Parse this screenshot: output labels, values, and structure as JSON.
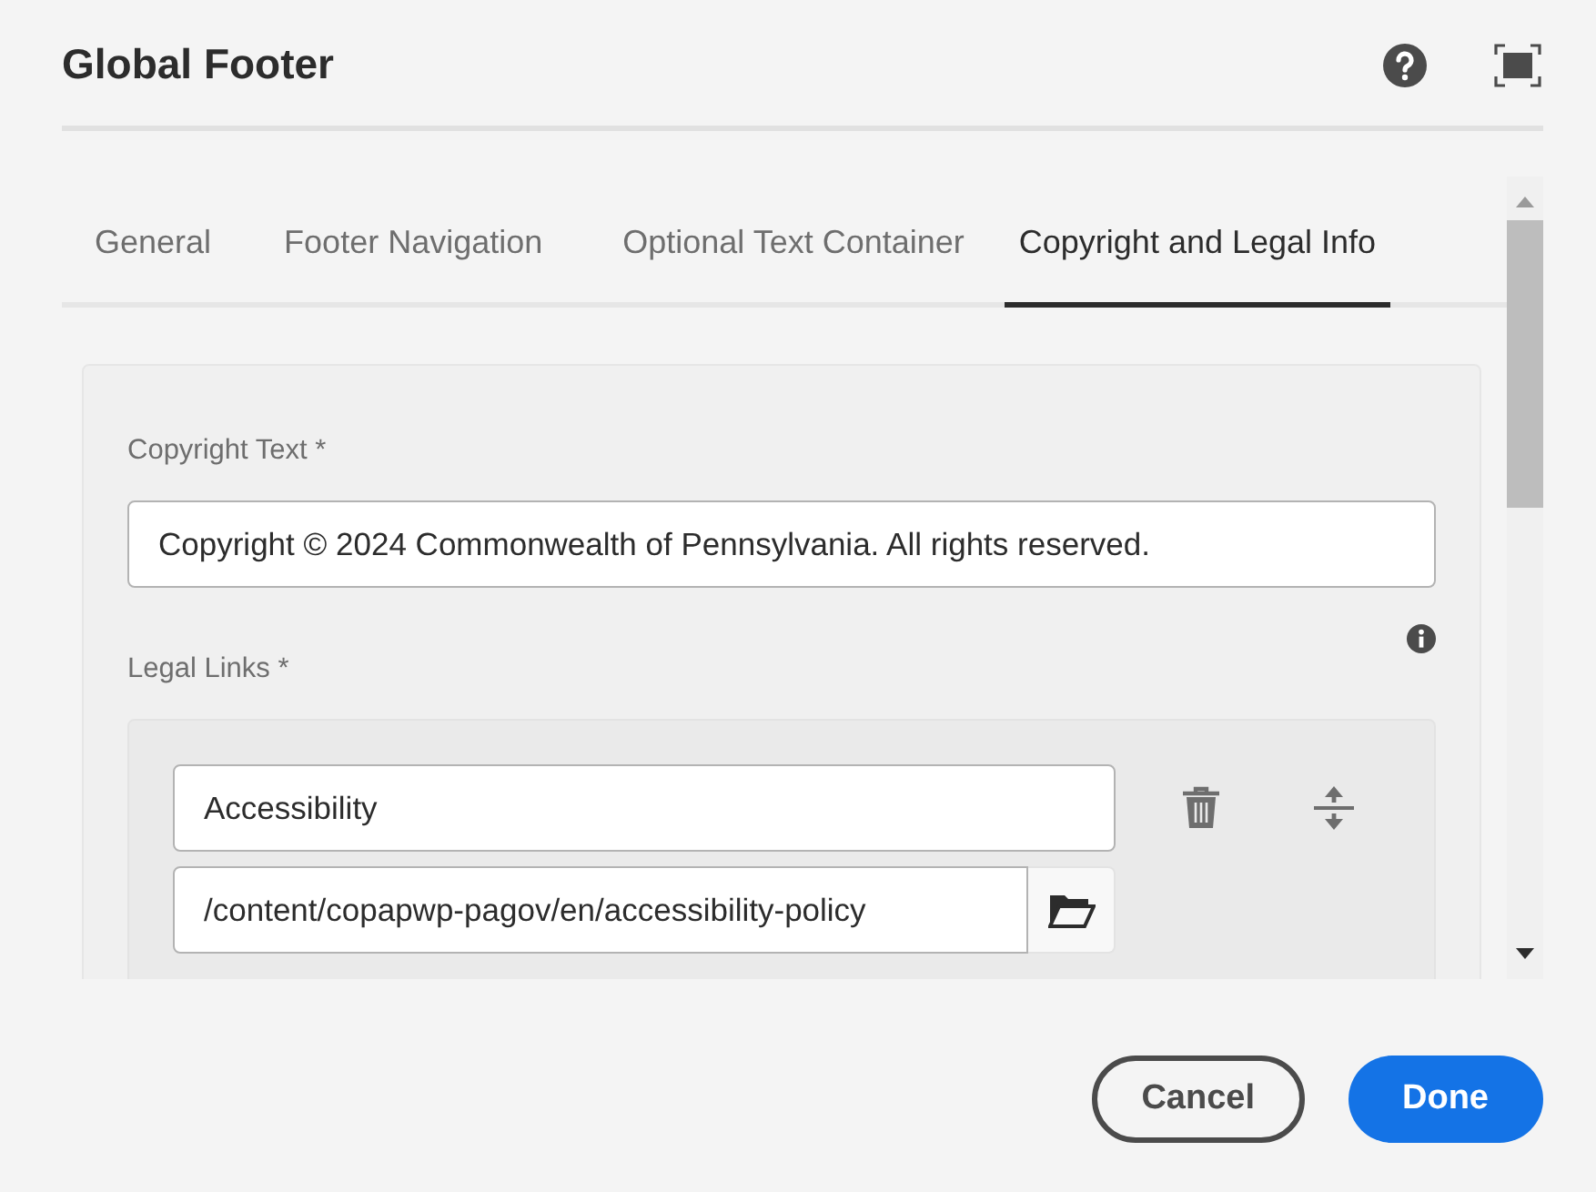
{
  "dialog": {
    "title": "Global Footer"
  },
  "tabs": [
    {
      "label": "General",
      "selected": false
    },
    {
      "label": "Footer Navigation",
      "selected": false
    },
    {
      "label": "Optional Text Container",
      "selected": false
    },
    {
      "label": "Copyright and Legal Info",
      "selected": true
    }
  ],
  "copyright": {
    "label": "Copyright Text *",
    "value": "Copyright © 2024 Commonwealth of Pennsylvania. All rights reserved."
  },
  "legal_links": {
    "label": "Legal Links *",
    "items": [
      {
        "title": "Accessibility",
        "path": "/content/copapwp-pagov/en/accessibility-policy"
      }
    ]
  },
  "buttons": [
    {
      "label": "Cancel",
      "kind": "secondary"
    },
    {
      "label": "Done",
      "kind": "primary"
    }
  ]
}
